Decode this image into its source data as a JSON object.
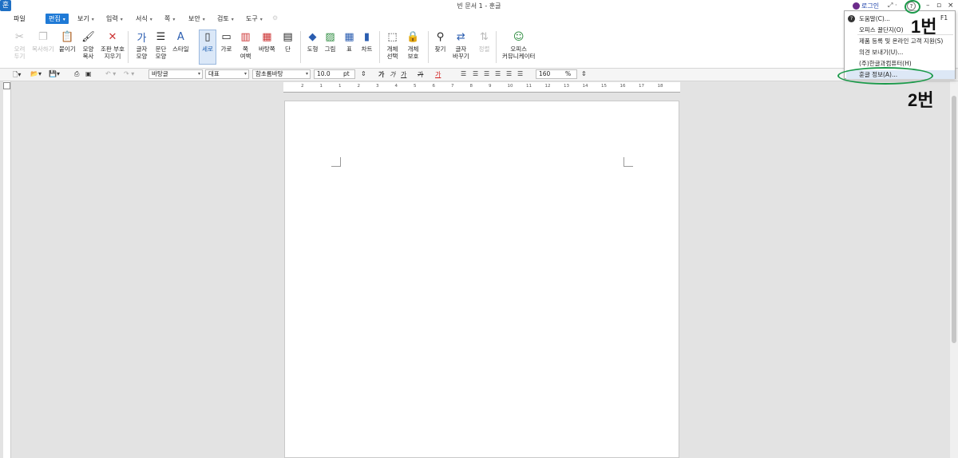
{
  "titlebar": {
    "logo": "훈",
    "title": "빈 문서 1 - 훈글",
    "login": "로그인",
    "help_icon": "?",
    "minimize": "–",
    "restore": "▫",
    "close": "×"
  },
  "menu": {
    "items": [
      {
        "label": "파일",
        "caret": false
      },
      {
        "label": "편집",
        "caret": true,
        "active": true
      },
      {
        "label": "보기",
        "caret": true
      },
      {
        "label": "입력",
        "caret": true
      },
      {
        "label": "서식",
        "caret": true
      },
      {
        "label": "쪽",
        "caret": true
      },
      {
        "label": "보안",
        "caret": true
      },
      {
        "label": "검토",
        "caret": true
      },
      {
        "label": "도구",
        "caret": true
      }
    ],
    "caret_glyph": "▾"
  },
  "ribbon": {
    "cut": "오려\n두기",
    "copy": "복사하기",
    "paste": "붙이기",
    "format_copy": "모양\n복사",
    "clear_format": "조판 부호\n지우기",
    "char_shape": "글자\n모양",
    "para_shape": "문단\n모양",
    "style": "스타일",
    "portrait": "세로",
    "landscape": "가로",
    "margin": "쪽\n여백",
    "background": "바탕쪽",
    "columns": "단",
    "shapes": "도형",
    "picture": "그림",
    "table": "표",
    "chart": "차트",
    "object_select": "개체\n선택",
    "object_protect": "개체\n보호",
    "find": "찾기",
    "replace": "글자\n바꾸기",
    "sort": "정렬",
    "office_community": "오피스\n커뮤니케이터"
  },
  "formatbar": {
    "style_value": "바탕글",
    "lang_value": "대표",
    "font_value": "함초롬바탕",
    "size_value": "10.0",
    "size_unit": "pt",
    "bold": "가",
    "italic": "가",
    "underline": "가",
    "strike": "가",
    "color": "가",
    "zoom_value": "160",
    "zoom_unit": "%"
  },
  "ruler": {
    "ticks": [
      "2",
      "1",
      "1",
      "2",
      "3",
      "4",
      "5",
      "6",
      "7",
      "8",
      "9",
      "10",
      "11",
      "12",
      "13",
      "14",
      "15",
      "16",
      "17",
      "18"
    ]
  },
  "help_menu": {
    "items": [
      {
        "label": "도움말(C)...",
        "shortcut": "F1"
      },
      {
        "label": "오피스 꿀단지(O)"
      },
      {
        "label": "제품 등록 및 온라인 고객 지원(S)"
      },
      {
        "label": "의견 보내기(U)..."
      },
      {
        "label": "(주)한글과컴퓨터(H)"
      },
      {
        "label": "훈글 정보(A)..."
      }
    ]
  },
  "annotations": {
    "step1": "1번",
    "step2": "2번"
  },
  "colors": {
    "accent": "#1f7ad6",
    "annotation_green": "#1b9a4a"
  }
}
